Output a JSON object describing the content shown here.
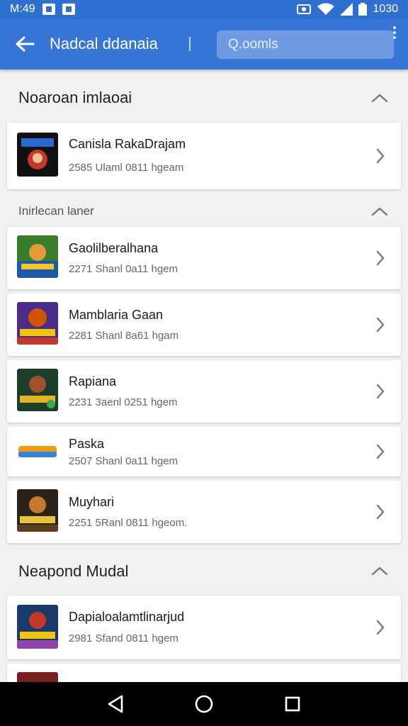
{
  "status_bar": {
    "time": "M:49",
    "battery": "1030"
  },
  "app_bar": {
    "title": "Nadcal ddanaia",
    "search_placeholder": "Q.oomls"
  },
  "sections": [
    {
      "title": "Noaroan imlaoai",
      "items": [
        {
          "name": "Canisla RakaDrajam",
          "meta": "2585 Ulaml 0811 hgeam",
          "thumb": "thumb-1"
        }
      ]
    },
    {
      "title": "Inirlecan laner",
      "items": [
        {
          "name": "Gaolilberalhana",
          "meta": "2271 Shanl 0a11 hgem",
          "thumb": "thumb-2"
        },
        {
          "name": "Mamblaria Gaan",
          "meta": "2281 Shanl 8a61 hgam",
          "thumb": "thumb-3"
        },
        {
          "name": "Rapiana",
          "meta": "2231 3aenl 0251 hgem",
          "thumb": "thumb-4"
        },
        {
          "name": "Paska",
          "meta": "2507 Shanl 0a11 hgem",
          "thumb": "thumb-5"
        },
        {
          "name": "Muyhari",
          "meta": "2251 5Ranl 0811 hgeom.",
          "thumb": "thumb-6"
        }
      ]
    },
    {
      "title": "Neapond Mudal",
      "items": [
        {
          "name": "Dapialoalamtlinarjud",
          "meta": "2981 Sfand 0811 hgem",
          "thumb": "thumb-7"
        }
      ]
    }
  ],
  "colors": {
    "primary": "#3775d6",
    "status": "#2f6fcf",
    "background": "#f1f1f1"
  }
}
